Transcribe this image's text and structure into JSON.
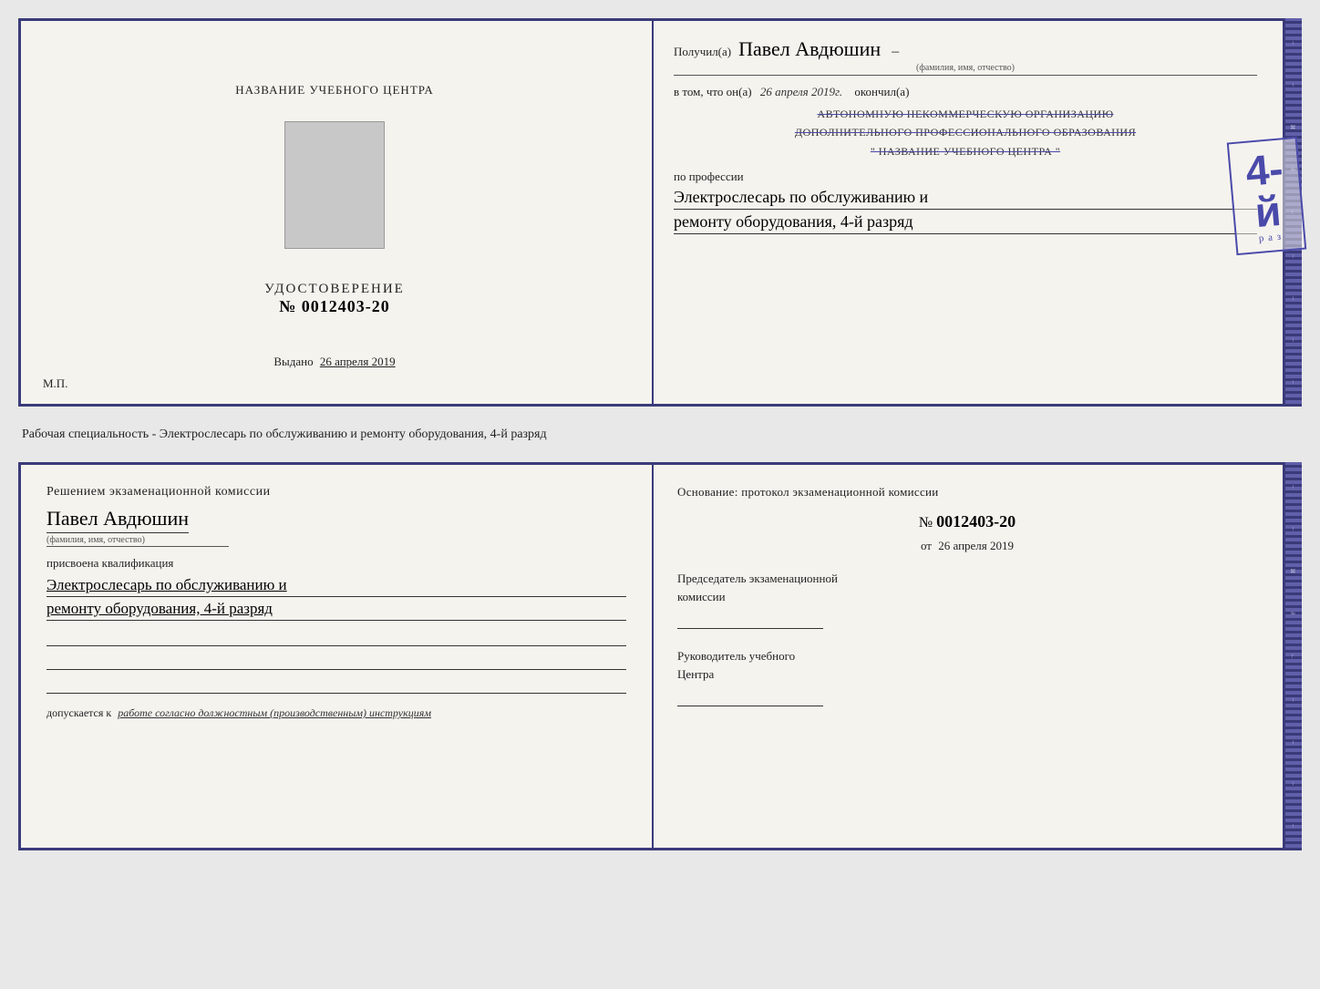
{
  "top_cert": {
    "left": {
      "title": "НАЗВАНИЕ УЧЕБНОГО ЦЕНТРА",
      "udostoverenie_label": "УДОСТОВЕРЕНИЕ",
      "number_prefix": "№",
      "number": "0012403-20",
      "vydano_label": "Выдано",
      "vydano_date": "26 апреля 2019",
      "mp": "М.П."
    },
    "right": {
      "poluchil_label": "Получил(а)",
      "fio": "Павел Авдюшин",
      "fio_subtitle": "(фамилия, имя, отчество)",
      "vtom_label": "в том, что он(а)",
      "date_italic": "26 апреля 2019г.",
      "okonchil_label": "окончил(а)",
      "grade_label": "4-й",
      "grade_suffix": "р аз",
      "stamp_line1": "АВТОНОМНУЮ НЕКОММЕРЧЕСКУЮ ОРГАНИЗАЦИЮ",
      "stamp_line2": "ДОПОЛНИТЕЛЬНОГО ПРОФЕССИОНАЛЬНОГО ОБРАЗОВАНИЯ",
      "stamp_line3": "\" НАЗВАНИЕ УЧЕБНОГО ЦЕНТРА \"",
      "po_professii_label": "по профессии",
      "profession_line1": "Электрослесарь по обслуживанию и",
      "profession_line2": "ремонту оборудования, 4-й разряд"
    }
  },
  "middle_text": "Рабочая специальность - Электрослесарь по обслуживанию и ремонту оборудования, 4-й разряд",
  "bottom_cert": {
    "left": {
      "resheniem_label": "Решением экзаменационной комиссии",
      "fio": "Павел Авдюшин",
      "fio_subtitle": "(фамилия, имя, отчество)",
      "prisvoena_label": "присвоена квалификация",
      "kvalif_line1": "Электрослесарь по обслуживанию и",
      "kvalif_line2": "ремонту оборудования, 4-й разряд",
      "dopuskaetsya_label": "допускается к",
      "dopusk_text": "работе согласно должностным (производственным) инструкциям"
    },
    "right": {
      "osnovanie_label": "Основание: протокол экзаменационной комиссии",
      "number_prefix": "№",
      "protocol_number": "0012403-20",
      "ot_label": "от",
      "ot_date": "26 апреля 2019",
      "chairman_label1": "Председатель экзаменационной",
      "chairman_label2": "комиссии",
      "rukovoditel_label1": "Руководитель учебного",
      "rukovoditel_label2": "Центра"
    }
  }
}
